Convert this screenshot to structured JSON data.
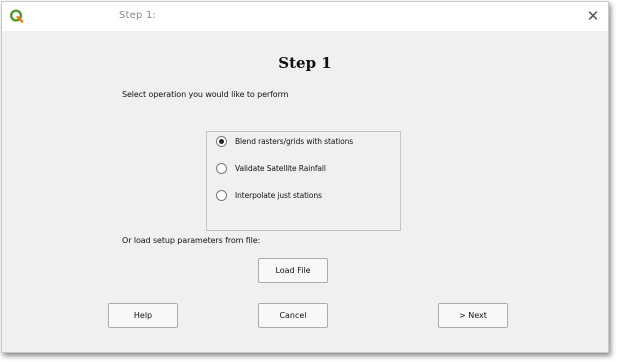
{
  "window": {
    "title": "Step 1:",
    "close_glyph": "✕"
  },
  "main": {
    "heading": "Step 1",
    "instruction": "Select operation you would like to perform",
    "options": [
      {
        "label": "Blend rasters/grids with stations",
        "checked": true
      },
      {
        "label": "Validate Satellite Rainfall",
        "checked": false
      },
      {
        "label": "Interpolate just stations",
        "checked": false
      }
    ],
    "load_setup_label": "Or load setup parameters from file:",
    "load_file_button": "Load File"
  },
  "footer": {
    "help_button": "Help",
    "cancel_button": "Cancel",
    "next_button": "> Next"
  },
  "colors": {
    "qgis_green": "#589632",
    "qgis_yellow": "#ee7913",
    "dialog_bg": "#f0f0f0"
  },
  "icons": {
    "app": "qgis-logo-icon",
    "close": "close-icon"
  }
}
